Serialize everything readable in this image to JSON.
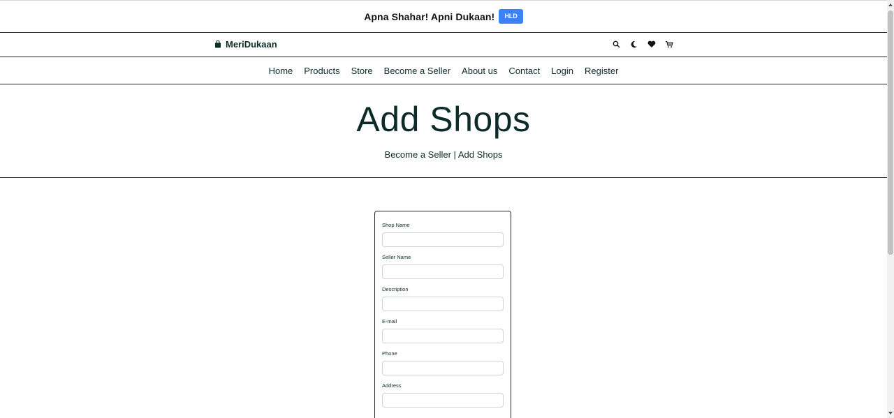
{
  "promo": {
    "text": "Apna Shahar! Apni Dukaan!",
    "badge": "HLD",
    "badge_color": "#3b82f6"
  },
  "brand": {
    "name": "MeriDukaan",
    "icon": "shopping-bag-icon"
  },
  "header_icons": [
    "search-icon",
    "moon-icon",
    "heart-icon",
    "cart-icon"
  ],
  "nav": {
    "items": [
      "Home",
      "Products",
      "Store",
      "Become a Seller",
      "About us",
      "Contact",
      "Login",
      "Register"
    ]
  },
  "hero": {
    "title": "Add Shops",
    "breadcrumb": {
      "parent": "Become a Seller",
      "separator": "|",
      "current": "Add Shops"
    }
  },
  "form": {
    "fields": [
      {
        "label": "Shop Name",
        "value": ""
      },
      {
        "label": "Seller Name",
        "value": ""
      },
      {
        "label": "Description",
        "value": ""
      },
      {
        "label": "E-mail",
        "value": ""
      },
      {
        "label": "Phone",
        "value": ""
      },
      {
        "label": "Address",
        "value": ""
      }
    ]
  },
  "colors": {
    "text_primary": "#0d2b29",
    "accent": "#3b82f6"
  }
}
